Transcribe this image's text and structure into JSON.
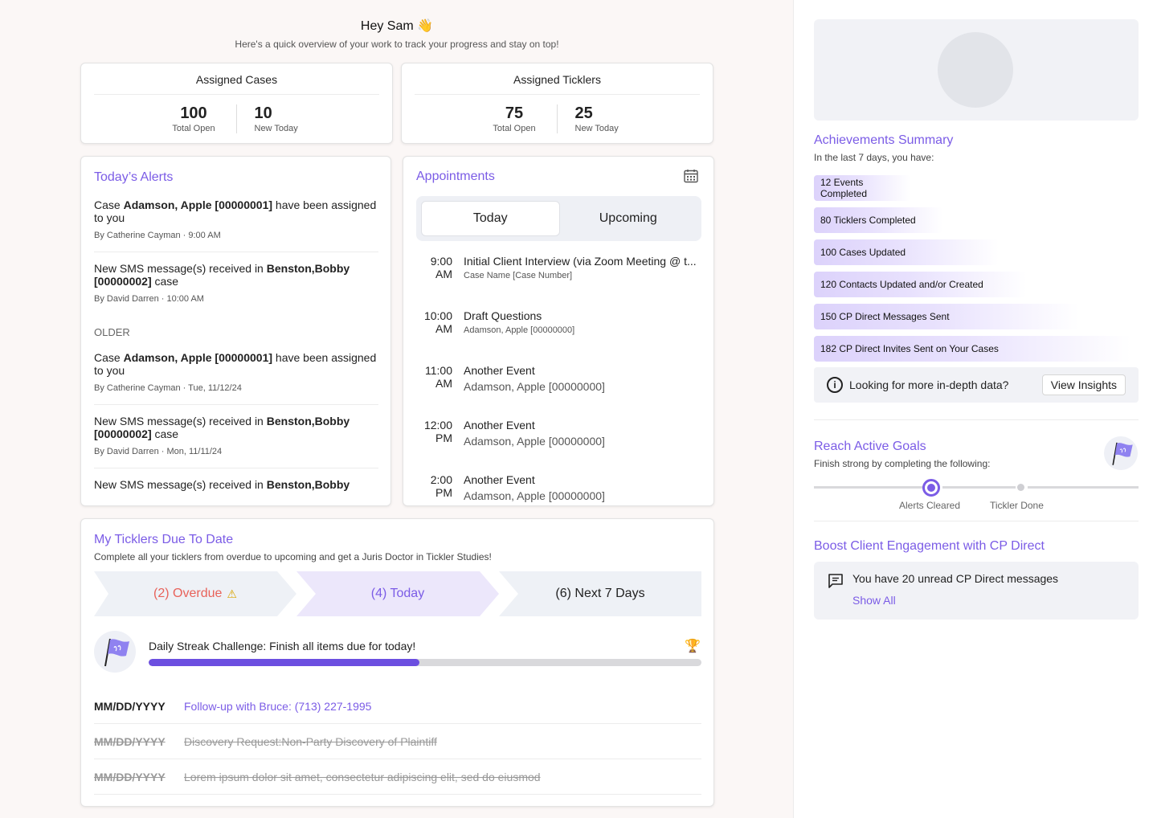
{
  "greeting": {
    "title": "Hey Sam",
    "emoji": "👋",
    "subtitle": "Here's a quick overview of your work to track your progress and stay on top!"
  },
  "assigned_cases": {
    "title": "Assigned Cases",
    "total_open": "100",
    "total_open_label": "Total Open",
    "new_today": "10",
    "new_today_label": "New Today"
  },
  "assigned_ticklers": {
    "title": "Assigned Ticklers",
    "total_open": "75",
    "total_open_label": "Total Open",
    "new_today": "25",
    "new_today_label": "New Today"
  },
  "alerts": {
    "title": "Today’s Alerts",
    "older_label": "OLDER",
    "items": [
      {
        "pre": "Case ",
        "bold": "Adamson, Apple [00000001]",
        "post": " have been assigned to you",
        "meta": "By Catherine Cayman · 9:00 AM"
      },
      {
        "pre": "New SMS message(s) received in ",
        "bold": "Benston,Bobby [00000002]",
        "post": " case",
        "meta": "By David Darren · 10:00 AM"
      },
      {
        "pre": "Case ",
        "bold": "Adamson, Apple [00000001]",
        "post": " have been assigned to you",
        "meta": "By Catherine Cayman · Tue, 11/12/24"
      },
      {
        "pre": "New SMS message(s) received in ",
        "bold": "Benston,Bobby [00000002]",
        "post": " case",
        "meta": "By David Darren ·  Mon, 11/11/24"
      },
      {
        "pre": "New SMS message(s) received in ",
        "bold": "Benston,Bobby",
        "post": "",
        "meta": ""
      }
    ]
  },
  "appointments": {
    "title": "Appointments",
    "tabs": {
      "today": "Today",
      "upcoming": "Upcoming"
    },
    "items": [
      {
        "time1": "9:00",
        "time2": "AM",
        "title": "Initial Client Interview (via Zoom Meeting @ t...",
        "sub": "Case Name [Case Number]"
      },
      {
        "time1": "10:00",
        "time2": "AM",
        "title": "Draft Questions",
        "sub": "Adamson, Apple [00000000]"
      },
      {
        "time1": "11:00",
        "time2": "AM",
        "title": "Another Event",
        "sub": "Adamson, Apple [00000000]"
      },
      {
        "time1": "12:00",
        "time2": "PM",
        "title": "Another Event",
        "sub": "Adamson, Apple [00000000]"
      },
      {
        "time1": "2:00",
        "time2": "PM",
        "title": "Another Event",
        "sub": "Adamson, Apple [00000000]"
      }
    ]
  },
  "ticklers": {
    "title": "My Ticklers Due To Date",
    "description": "Complete all your ticklers from overdue to upcoming and get a Juris Doctor  in Tickler Studies!",
    "tabs": {
      "overdue": "(2) Overdue",
      "today": "(4) Today",
      "next7": "(6) Next 7 Days"
    },
    "streak_text": "Daily Streak Challenge: Finish all items due for today!",
    "streak_progress_percent": 49,
    "rows": [
      {
        "date": "MM/DD/YYYY",
        "task": "Follow-up with Bruce: (713) 227-1995"
      },
      {
        "date": "MM/DD/YYYY",
        "task": "Discovery Request:Non-Party Discovery of Plaintiff"
      },
      {
        "date": "MM/DD/YYYY",
        "task": "Lorem ipsum dolor sit amet, consectetur adipiscing elit, sed do eiusmod"
      }
    ]
  },
  "achievements": {
    "title": "Achievements Summary",
    "subtitle": "In the last 7 days, you have:",
    "items": [
      "12 Events Completed",
      "80 Ticklers Completed",
      "100 Cases Updated",
      "120 Contacts Updated and/or Created",
      "150 CP Direct Messages Sent",
      "182 CP Direct Invites Sent on Your Cases"
    ],
    "insights_text": "Looking for more in-depth data?",
    "insights_button": "View Insights"
  },
  "goals": {
    "title": "Reach Active Goals",
    "subtitle": "Finish strong by completing the following:",
    "step1": "Alerts Cleared",
    "step2": "Tickler Done"
  },
  "boost": {
    "title": "Boost Client Engagement with CP Direct",
    "message": "You have 20 unread CP Direct messages",
    "link": "Show All"
  },
  "colors": {
    "accent": "#7b5ce6",
    "overdue": "#e8625a",
    "progress": "#6c4fe0"
  }
}
